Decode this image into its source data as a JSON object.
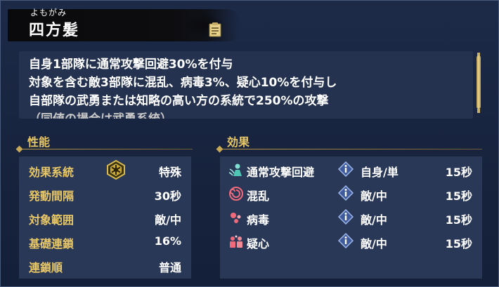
{
  "header": {
    "furigana": "よもがみ",
    "title": "四方髪"
  },
  "description": {
    "lines": [
      "自身1部隊に通常攻撃回避30%を付与",
      "対象を含む敵3部隊に混乱、病毒3%、疑心10%を付与し",
      "自部隊の武勇または知略の高い方の系統で250%の攻撃",
      "（同値の場合は武勇系統）"
    ]
  },
  "stats": {
    "heading": "性能",
    "rows": [
      {
        "label": "効果系統",
        "value": "特殊",
        "icon": "hex-badge-icon"
      },
      {
        "label": "発動間隔",
        "value": "30秒"
      },
      {
        "label": "対象範囲",
        "value": "敵/中"
      },
      {
        "label": "基礎連鎖",
        "value": "16%"
      },
      {
        "label": "連鎖順",
        "value": "普通"
      }
    ]
  },
  "effects": {
    "heading": "効果",
    "rows": [
      {
        "name": "通常攻撃回避",
        "target": "自身/単",
        "duration": "15秒",
        "icon": "evade-icon"
      },
      {
        "name": "混乱",
        "target": "敵/中",
        "duration": "15秒",
        "icon": "confusion-icon"
      },
      {
        "name": "病毒",
        "target": "敵/中",
        "duration": "15秒",
        "icon": "poison-icon"
      },
      {
        "name": "疑心",
        "target": "敵/中",
        "duration": "15秒",
        "icon": "suspicion-icon"
      }
    ]
  },
  "colors": {
    "accent_gold": "#e8c766",
    "panel_bg": "#1c2a48",
    "box_bg": "#2a3858"
  }
}
